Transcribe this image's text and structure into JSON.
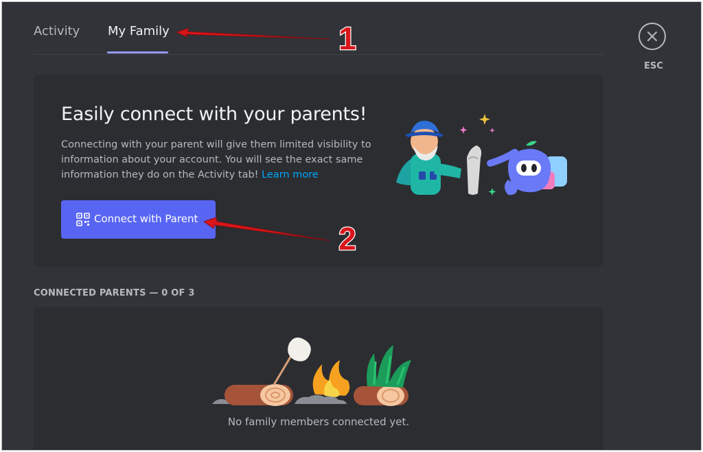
{
  "tabs": [
    {
      "label": "Activity",
      "active": false
    },
    {
      "label": "My Family",
      "active": true
    }
  ],
  "close": {
    "esc_label": "ESC",
    "icon": "close-icon"
  },
  "connect_card": {
    "title": "Easily connect with your parents!",
    "description": "Connecting with your parent will give them limited visibility to information about your account. You will see the exact same information they do on the Activity tab!",
    "link_text": "Learn more",
    "button_label": "Connect with Parent",
    "button_icon": "qr-code-icon"
  },
  "connected_parents": {
    "header": "CONNECTED PARENTS — 0 OF 3",
    "empty_message": "No family members connected yet."
  },
  "annotations": {
    "step1": "1",
    "step2": "2"
  },
  "colors": {
    "background": "#313338",
    "card": "#2b2d31",
    "accent": "#5865f2",
    "tab_underline": "#949cf7",
    "link": "#00a8fc",
    "annotation_arrow": "#d8161b"
  }
}
